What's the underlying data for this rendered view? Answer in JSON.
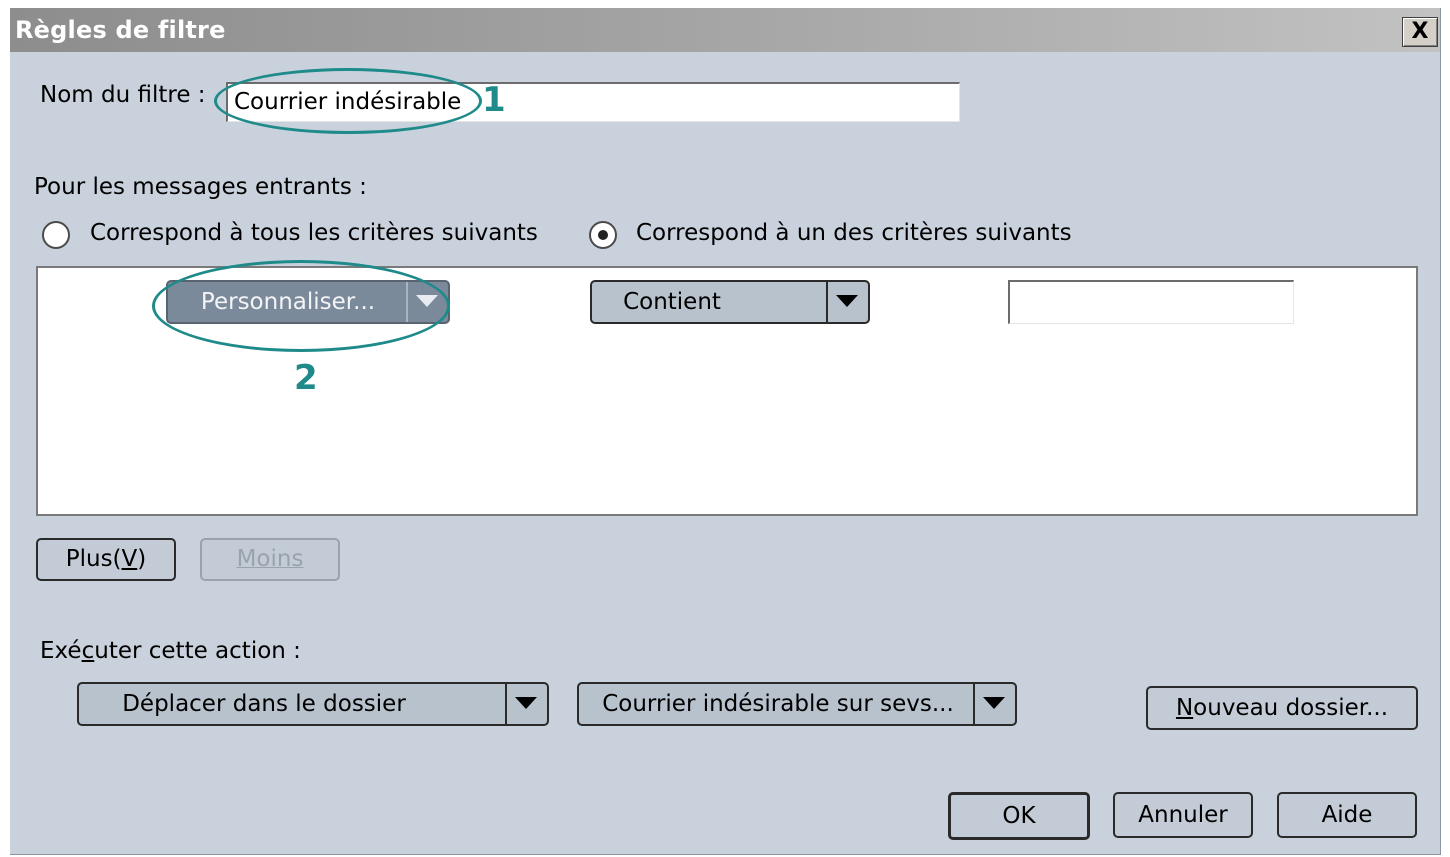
{
  "window": {
    "title": "Règles de filtre",
    "close_label": "X"
  },
  "filter_name": {
    "label": "Nom du filtre :",
    "value": "Courrier indésirable"
  },
  "incoming": {
    "label": "Pour les messages entrants :",
    "radio_all": {
      "label": "Correspond à tous les critères suivants",
      "selected": false
    },
    "radio_any": {
      "label": "Correspond à un des critères suivants",
      "selected": true
    }
  },
  "criteria": [
    {
      "field": "Personnaliser...",
      "operator": "Contient",
      "value": ""
    }
  ],
  "buttons": {
    "more_prefix": "Plus(",
    "more_key": "V",
    "more_suffix": ")",
    "less": "Moins"
  },
  "action": {
    "label_pre": "Exé",
    "label_key": "c",
    "label_post": "uter cette action :",
    "action_value": "Déplacer dans le dossier",
    "folder_value": "Courrier indésirable sur sevs...",
    "new_folder_key": "N",
    "new_folder_rest": "ouveau dossier..."
  },
  "footer": {
    "ok": "OK",
    "cancel": "Annuler",
    "help": "Aide"
  },
  "annotations": {
    "callout_1": "1",
    "callout_2": "2",
    "color": "#1f8a8a"
  }
}
